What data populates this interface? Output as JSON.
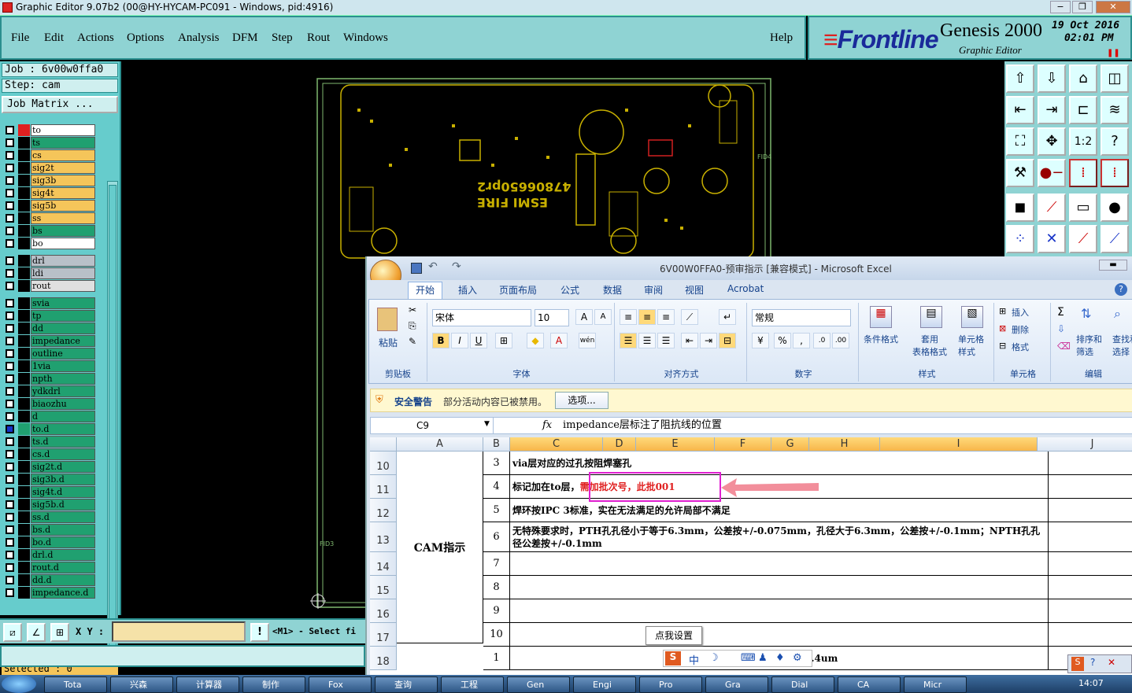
{
  "genesis": {
    "window_title": "Graphic Editor 9.07b2 (00@HY-HYCAM-PC091 - Windows, pid:4916)",
    "menu": [
      "File",
      "Edit",
      "Actions",
      "Options",
      "Analysis",
      "DFM",
      "Step",
      "Rout",
      "Windows"
    ],
    "help": "Help",
    "brand": {
      "name_prefix": "Front",
      "name_suffix": "line",
      "product": "Genesis 2000",
      "subtitle": "Graphic Editor",
      "date": "19 Oct 2016",
      "time": "02:01 PM"
    },
    "job": "Job  :  6v00w0ffa0",
    "step": "Step:  cam",
    "job_matrix": "Job Matrix ...",
    "layers_group1": [
      {
        "name": "to",
        "color": "#e02020",
        "bg": "#ffffff"
      },
      {
        "name": "ts",
        "color": "#20a070",
        "bg": "#20a070"
      },
      {
        "name": "cs",
        "color": "#f5c55a",
        "bg": "#f5c55a"
      },
      {
        "name": "sig2t",
        "color": "#f5c55a",
        "bg": "#f5c55a"
      },
      {
        "name": "sig3b",
        "color": "#f5c55a",
        "bg": "#f5c55a"
      },
      {
        "name": "sig4t",
        "color": "#f5c55a",
        "bg": "#f5c55a"
      },
      {
        "name": "sig5b",
        "color": "#f5c55a",
        "bg": "#f5c55a"
      },
      {
        "name": "ss",
        "color": "#f5c55a",
        "bg": "#f5c55a"
      },
      {
        "name": "bs",
        "color": "#20a070",
        "bg": "#20a070"
      },
      {
        "name": "bo",
        "color": "#ffffff",
        "bg": "#ffffff"
      }
    ],
    "layers_group2": [
      {
        "name": "drl",
        "color": "#b8c0c8",
        "bg": "#b8c0c8"
      },
      {
        "name": "ldi",
        "color": "#b8c0c8",
        "bg": "#b8c0c8"
      },
      {
        "name": "rout",
        "color": "#e0e0e0",
        "bg": "#e0e0e0"
      }
    ],
    "layers_group3": [
      "svia",
      "tp",
      "dd",
      "impedance",
      "outline",
      "1via",
      "npth",
      "ydkdrl",
      "biaozhu",
      "d",
      "to.d",
      "ts.d",
      "cs.d",
      "sig2t.d",
      "sig3b.d",
      "sig4t.d",
      "sig5b.d",
      "ss.d",
      "bs.d",
      "bo.d",
      "drl.d",
      "rout.d",
      "dd.d",
      "impedance.d"
    ],
    "selected": "Selected : 0",
    "xy_label": "X Y :",
    "mode_text": "<M1> - Select fi",
    "pcb_text1": "47806650pr2",
    "pcb_text2": "ESMI  FIRE",
    "pcb_labels": [
      "FID4",
      "FID3"
    ]
  },
  "excel": {
    "title": "6V00W0FFA0-预审指示  [兼容模式]  -  Microsoft Excel",
    "tabs": [
      "开始",
      "插入",
      "页面布局",
      "公式",
      "数据",
      "审阅",
      "视图",
      "Acrobat"
    ],
    "ribbon": {
      "paste": "粘贴",
      "font": "宋体",
      "size": "10",
      "number_format": "常规",
      "groups": [
        "剪贴板",
        "字体",
        "对齐方式",
        "数字",
        "样式",
        "单元格",
        "编辑"
      ],
      "style_buttons": [
        "条件格式",
        "套用\n表格格式",
        "单元格\n样式"
      ],
      "cells_buttons": [
        "插入",
        "删除",
        "格式"
      ],
      "edit_buttons": [
        "排序和\n筛选",
        "查找和\n选择"
      ]
    },
    "security_title": "安全警告",
    "security_text": "部分活动内容已被禁用。",
    "options_button": "选项...",
    "name_box": "C9",
    "formula": "impedance层标注了阻抗线的位置",
    "columns": [
      "A",
      "B",
      "C",
      "D",
      "E",
      "F",
      "G",
      "H",
      "I",
      "J"
    ],
    "rows": [
      {
        "num": "10",
        "idx": "3",
        "text": "via层对应的过孔按阻焊塞孔"
      },
      {
        "num": "11",
        "idx": "4",
        "text": "标记加在to层，",
        "red": "需加批次号，此批001"
      },
      {
        "num": "12",
        "idx": "5",
        "text": "焊环按IPC 3标准，实在无法满足的允许局部不满足"
      },
      {
        "num": "13",
        "idx": "6",
        "text": "无特殊要求时，PTH孔孔径小于等于6.3mm，公差按+/-0.075mm，孔径大于6.3mm，公差按+/-0.1mm；NPTH孔孔径公差按+/-0.1mm"
      },
      {
        "num": "14",
        "idx": "7",
        "text": ""
      },
      {
        "num": "15",
        "idx": "8",
        "text": ""
      },
      {
        "num": "16",
        "idx": "9",
        "text": ""
      },
      {
        "num": "17",
        "idx": "10",
        "text": ""
      },
      {
        "num": "18",
        "idx": "1",
        "text": "外层最小完成铜厚33.4um"
      }
    ],
    "cam_label": "CAM指示",
    "tooltip": "点我设置",
    "ime_text": "中"
  },
  "taskbar": {
    "items": [
      "Tota",
      "兴森",
      "计算器",
      "制作",
      "Fox",
      "查询",
      "工程",
      "Gen",
      "Engi",
      "Pro",
      "Gra",
      "Dial",
      "CA",
      "Micr"
    ],
    "clock": "14:07"
  }
}
